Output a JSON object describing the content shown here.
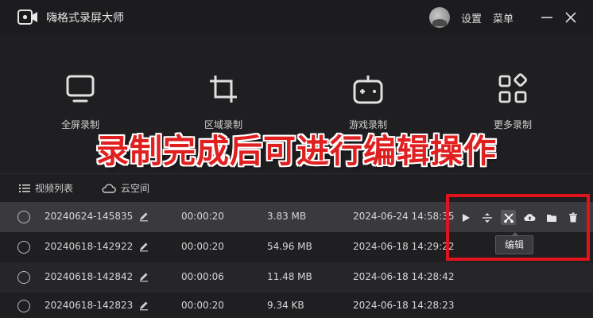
{
  "app": {
    "title": "嗨格式录屏大师"
  },
  "header": {
    "settings_label": "设置",
    "menu_label": "菜单"
  },
  "modes": [
    {
      "label": "全屏录制",
      "icon": "monitor-icon"
    },
    {
      "label": "区域录制",
      "icon": "crop-icon"
    },
    {
      "label": "游戏录制",
      "icon": "gamepad-icon"
    },
    {
      "label": "更多录制",
      "icon": "grid-icon"
    }
  ],
  "overlay_caption": "录制完成后可进行编辑操作",
  "tabs": [
    {
      "label": "视频列表",
      "icon": "list-icon"
    },
    {
      "label": "云空间",
      "icon": "cloud-icon"
    }
  ],
  "recordings": [
    {
      "name": "20240624-145835",
      "duration": "00:00:20",
      "size": "3.83 MB",
      "date": "2024-06-24 14:58:35"
    },
    {
      "name": "20240618-142922",
      "duration": "00:00:20",
      "size": "54.96 MB",
      "date": "2024-06-18 14:29:22"
    },
    {
      "name": "20240618-142842",
      "duration": "00:00:06",
      "size": "11.48 MB",
      "date": "2024-06-18 14:28:42"
    },
    {
      "name": "20240618-142823",
      "duration": "00:00:20",
      "size": "9.34 KB",
      "date": "2024-06-18 14:28:23"
    }
  ],
  "row_actions": [
    "play-icon",
    "split-icon",
    "scissors-icon",
    "cloud-upload-icon",
    "folder-icon",
    "trash-icon"
  ],
  "tooltip": {
    "text": "编辑"
  },
  "colors": {
    "background": "#1f1f22",
    "selected_row": "#3a3a3e",
    "highlight": "#e0141c",
    "caption": "#e02020"
  }
}
